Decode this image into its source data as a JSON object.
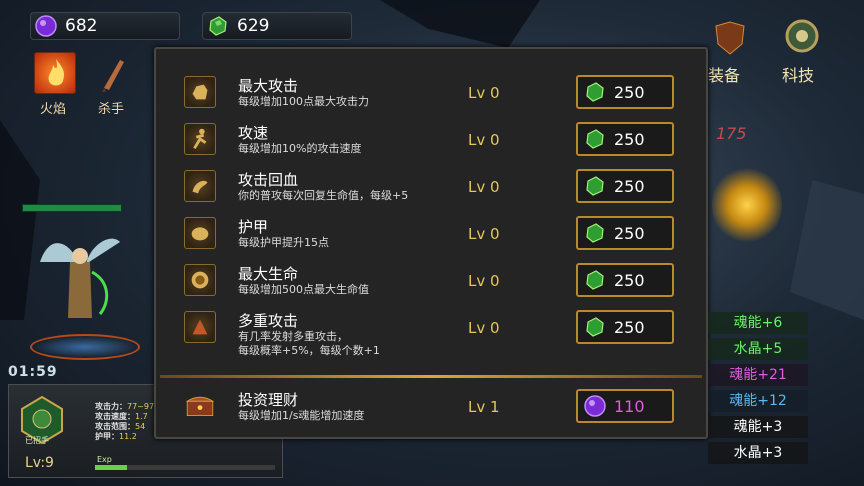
{
  "currencies": {
    "soul_amount": "682",
    "crystal_amount": "629"
  },
  "skills": [
    {
      "label": "火焰"
    },
    {
      "label": "杀手"
    }
  ],
  "top_right": {
    "equipment_label": "装备",
    "tech_label": "科技"
  },
  "upgrade_panel": {
    "rows": [
      {
        "name": "最大攻击",
        "desc": "每级增加100点最大攻击力",
        "level": "Lv 0",
        "cost": "250",
        "currency": "crystal"
      },
      {
        "name": "攻速",
        "desc": "每级增加10%的攻击速度",
        "level": "Lv 0",
        "cost": "250",
        "currency": "crystal"
      },
      {
        "name": "攻击回血",
        "desc": "你的普攻每次回复生命值，每级+5",
        "level": "Lv 0",
        "cost": "250",
        "currency": "crystal"
      },
      {
        "name": "护甲",
        "desc": "每级护甲提升15点",
        "level": "Lv 0",
        "cost": "250",
        "currency": "crystal"
      },
      {
        "name": "最大生命",
        "desc": "每级增加500点最大生命值",
        "level": "Lv 0",
        "cost": "250",
        "currency": "crystal"
      },
      {
        "name": "多重攻击",
        "desc": "有几率发射多重攻击，",
        "desc2": "每级概率+5%，每级个数+1",
        "level": "Lv 0",
        "cost": "250",
        "currency": "crystal"
      }
    ],
    "investment": {
      "name": "投资理财",
      "desc": "每级增加1/s魂能增加速度",
      "level": "Lv 1",
      "cost": "110",
      "currency": "soul"
    }
  },
  "reward_feed": [
    {
      "text": "魂能+6",
      "color": "#6cf06c"
    },
    {
      "text": "水晶+5",
      "color": "#6cf06c"
    },
    {
      "text": "魂能+21",
      "color": "#e05ce0"
    },
    {
      "text": "魂能+12",
      "color": "#5ab8f0"
    },
    {
      "text": "魂能+3",
      "color": "#ffffff"
    },
    {
      "text": "水晶+3",
      "color": "#ffffff"
    }
  ],
  "hero": {
    "timer": "01:59",
    "level": "Lv:9",
    "badge_text": "已招手",
    "exp_label": "Exp",
    "exp_progress": 0.18,
    "stats": [
      {
        "label": "攻击力：",
        "value": "77~97"
      },
      {
        "label": "攻击速度：",
        "value": "1.7"
      },
      {
        "label": "攻击范围：",
        "value": "54"
      },
      {
        "label": "护甲：",
        "value": "11.2"
      }
    ]
  },
  "scene": {
    "enemy_damage_text": "175"
  }
}
